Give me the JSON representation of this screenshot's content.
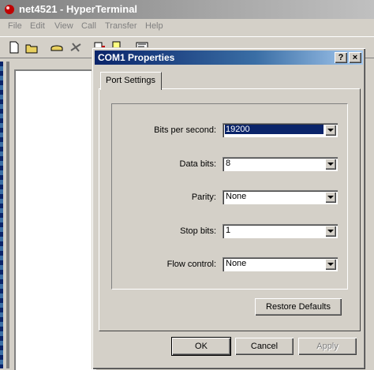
{
  "background_window": {
    "title": "net4521 - HyperTerminal",
    "menu": [
      "File",
      "Edit",
      "View",
      "Call",
      "Transfer",
      "Help"
    ]
  },
  "dialog": {
    "title": "COM1 Properties",
    "help_button": "?",
    "close_button": "×",
    "tabs": [
      "Port Settings"
    ],
    "fields": [
      {
        "label": "Bits per second:",
        "value": "19200",
        "selected": true
      },
      {
        "label": "Data bits:",
        "value": "8"
      },
      {
        "label": "Parity:",
        "value": "None"
      },
      {
        "label": "Stop bits:",
        "value": "1"
      },
      {
        "label": "Flow control:",
        "value": "None"
      }
    ],
    "restore_defaults": "Restore Defaults",
    "ok": "OK",
    "cancel": "Cancel",
    "apply": "Apply"
  }
}
